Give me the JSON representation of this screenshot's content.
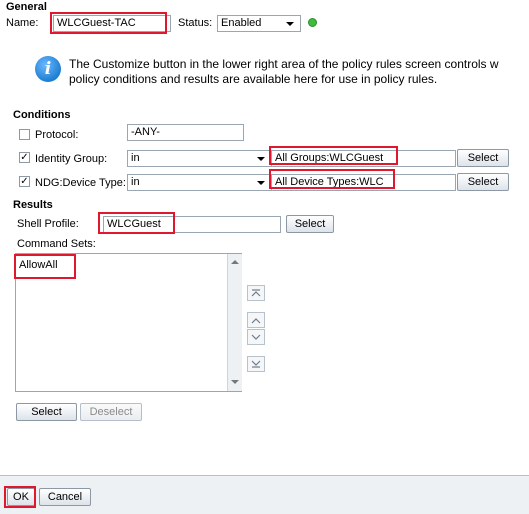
{
  "general": {
    "header": "General",
    "name_label": "Name:",
    "name_value": "WLCGuest-TAC",
    "status_label": "Status:",
    "status_value": "Enabled",
    "status_color": "#3dbb3d"
  },
  "info": {
    "icon": "info-icon",
    "line1": "The Customize button in the lower right area of the policy rules screen controls w",
    "line2": "policy conditions and results are available here for use in policy rules."
  },
  "conditions": {
    "header": "Conditions",
    "rows": [
      {
        "label": "Protocol:",
        "checked": false,
        "value": "-ANY-"
      },
      {
        "label": "Identity Group:",
        "checked": true,
        "operator": "in",
        "value": "All Groups:WLCGuest",
        "select_label": "Select"
      },
      {
        "label": "NDG:Device Type:",
        "checked": true,
        "operator": "in",
        "value": "All Device Types:WLC",
        "select_label": "Select"
      }
    ]
  },
  "results": {
    "header": "Results",
    "shell_profile_label": "Shell Profile:",
    "shell_profile_value": "WLCGuest",
    "shell_select_label": "Select",
    "command_sets_label": "Command Sets:",
    "command_sets": [
      "AllowAll"
    ],
    "select_label": "Select",
    "deselect_label": "Deselect"
  },
  "footer": {
    "ok_label": "OK",
    "cancel_label": "Cancel"
  },
  "colors": {
    "highlight": "#e0182d",
    "info_blue": "#1d7fd1"
  }
}
